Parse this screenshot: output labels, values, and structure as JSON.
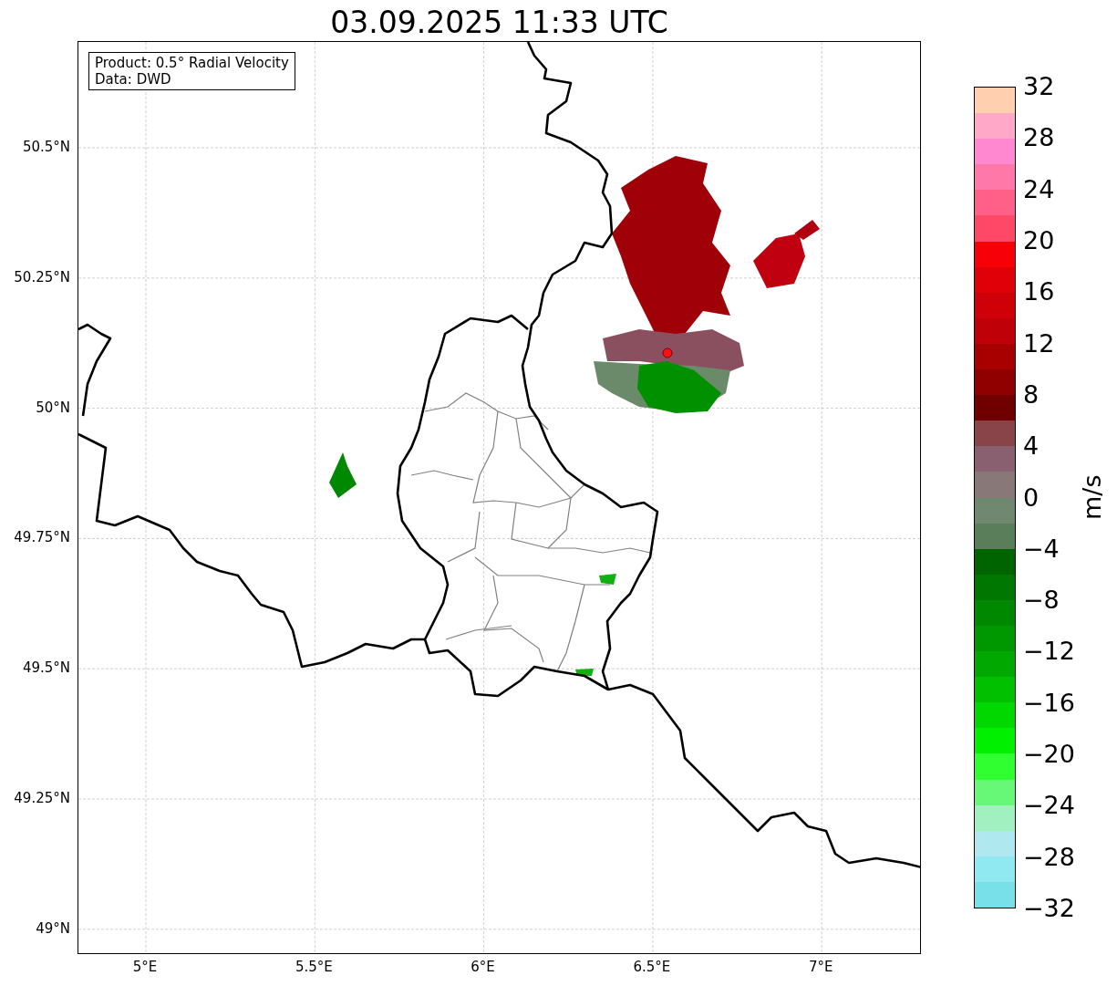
{
  "title": "03.09.2025 11:33 UTC",
  "map": {
    "legend": [
      "Product: 0.5° Radial Velocity",
      "Data: DWD"
    ],
    "lat_ticks": [
      "50.5°N",
      "50.25°N",
      "50°N",
      "49.75°N",
      "49.5°N",
      "49.25°N",
      "49°N"
    ],
    "lon_ticks": [
      "5°E",
      "5.5°E",
      "6°E",
      "6.5°E",
      "7°E"
    ]
  },
  "colorbar": {
    "label": "m/s",
    "ticks": [
      "32",
      "28",
      "24",
      "20",
      "16",
      "12",
      "8",
      "4",
      "0",
      "−4",
      "−8",
      "−12",
      "−16",
      "−20",
      "−24",
      "−28",
      "−32"
    ],
    "segments": [
      {
        "color": "#ffcfaf"
      },
      {
        "color": "#ffa8c8"
      },
      {
        "color": "#ff88d0"
      },
      {
        "color": "#ff78a8"
      },
      {
        "color": "#ff6088"
      },
      {
        "color": "#ff4868"
      },
      {
        "color": "#f80008"
      },
      {
        "color": "#e00008"
      },
      {
        "color": "#d00008"
      },
      {
        "color": "#c00008"
      },
      {
        "color": "#a80000"
      },
      {
        "color": "#900000"
      },
      {
        "color": "#700000"
      },
      {
        "color": "#884448"
      },
      {
        "color": "#886070"
      },
      {
        "color": "#887878"
      },
      {
        "color": "#708870"
      },
      {
        "color": "#5a7e5a"
      },
      {
        "color": "#006400"
      },
      {
        "color": "#007800"
      },
      {
        "color": "#008800"
      },
      {
        "color": "#009800"
      },
      {
        "color": "#00a800"
      },
      {
        "color": "#00c000"
      },
      {
        "color": "#00d800"
      },
      {
        "color": "#00f000"
      },
      {
        "color": "#30ff30"
      },
      {
        "color": "#68f878"
      },
      {
        "color": "#a0f0c0"
      },
      {
        "color": "#b0e8f0"
      },
      {
        "color": "#90e8f0"
      },
      {
        "color": "#78e0e8"
      }
    ]
  }
}
